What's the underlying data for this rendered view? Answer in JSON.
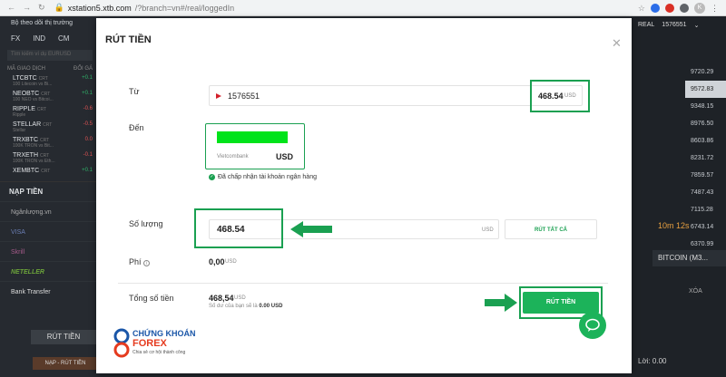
{
  "browser": {
    "url_domain": "xstation5.xtb.com",
    "url_path": "/?branch=vn#/real/loggedIn",
    "profile_initial": "K"
  },
  "left_panel": {
    "header": "Bộ theo dõi thị trường",
    "tabs": [
      "FX",
      "IND",
      "CM"
    ],
    "search_placeholder": "Tìm kiếm ví dụ EURUSD",
    "columns": [
      "MÃ GIAO DỊCH",
      "ĐỔI GÁ"
    ],
    "instruments": [
      {
        "name": "LTCBTC",
        "tag": "CRT",
        "sub": "100 Litecoin vs Bi...",
        "change": "+0.1",
        "pos": true
      },
      {
        "name": "NEOBTC",
        "tag": "CRT",
        "sub": "100 NEO vs Bitcoi...",
        "change": "+0.1",
        "pos": true
      },
      {
        "name": "RIPPLE",
        "tag": "CRT",
        "sub": "Ripple",
        "change": "-0.6",
        "pos": false
      },
      {
        "name": "STELLAR",
        "tag": "CRT",
        "sub": "Stellar",
        "change": "-0.5",
        "pos": false
      },
      {
        "name": "TRXBTC",
        "tag": "CRT",
        "sub": "100K TRON vs Bit...",
        "change": "0.0",
        "pos": false
      },
      {
        "name": "TRXETH",
        "tag": "CRT",
        "sub": "100K TRON vs Eth...",
        "change": "-0.1",
        "pos": false
      },
      {
        "name": "XEMBTC",
        "tag": "CRT",
        "sub": "",
        "change": "+0.1",
        "pos": true
      }
    ],
    "deposit_section": "NẠP TIỀN",
    "payment_methods": [
      "Ngânlượng.vn",
      "VISA",
      "Skrill",
      "NETELLER",
      "Bank Transfer"
    ],
    "withdraw_button": "RÚT TIỀN",
    "bottom_button": "NẠP - RÚT TIỀN"
  },
  "right_panel": {
    "account_type": "REAL",
    "account_number": "1576551",
    "prices": [
      "9720.29",
      "9572.83",
      "9348.15",
      "8976.50",
      "8603.86",
      "8231.72",
      "7859.57",
      "7487.43",
      "7115.28",
      "6743.14",
      "6370.99"
    ],
    "highlight_price": "9572.83",
    "timer": "10m 12s",
    "instrument_tab": "BITCOIN (M3...",
    "delete_label": "XÓA",
    "profit_label": "Lời: 0.00"
  },
  "modal": {
    "title": "RÚT TIỀN",
    "from_label": "Từ",
    "from_account": "1576551",
    "from_amount": "468.54",
    "from_currency": "USD",
    "to_label": "Đến",
    "bank_name": "Vietcombank",
    "bank_currency": "USD",
    "accepted_text": "Đã chấp nhận tài khoản ngân hàng",
    "quantity_label": "Số lượng",
    "quantity_value": "468.54",
    "quantity_currency": "USD",
    "withdraw_all": "RÚT TẤT CẢ",
    "fee_label": "Phí",
    "fee_value": "0,00",
    "fee_currency": "USD",
    "total_label": "Tổng số tiền",
    "total_value": "468,54",
    "total_currency": "USD",
    "balance_text": "Số dư của bạn sẽ là",
    "balance_value": "0.00 USD",
    "submit_button": "RÚT TIỀN",
    "colors": {
      "accent": "#1cb35a",
      "highlight": "#1aa051",
      "bank_block": "#00e31a"
    }
  },
  "watermark": {
    "line1": "CHỨNG KHOÁN",
    "line2": "FOREX",
    "line3": "Chia sẻ cơ hội thành công"
  }
}
